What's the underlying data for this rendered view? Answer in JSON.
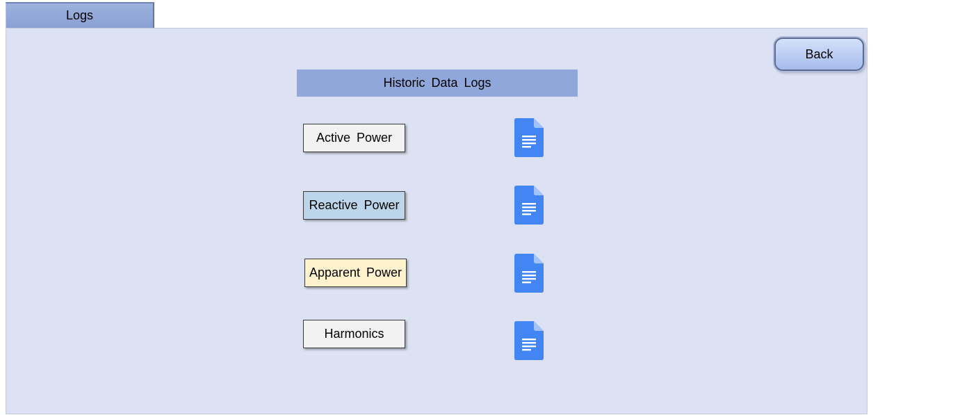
{
  "tab": {
    "label": "Logs"
  },
  "back_button": {
    "label": "Back"
  },
  "section": {
    "title": "Historic Data Logs"
  },
  "logs": [
    {
      "label": "Active Power",
      "bg": "#f2f2f2",
      "icon": "document-icon"
    },
    {
      "label": "Reactive Power",
      "bg": "#bcd5ea",
      "icon": "document-icon"
    },
    {
      "label": "Apparent Power",
      "bg": "#fff2cc",
      "icon": "document-icon"
    },
    {
      "label": "Harmonics",
      "bg": "#f2f2f2",
      "icon": "document-icon"
    }
  ],
  "colors": {
    "panel": "#dce2f3",
    "header": "#8fa7da",
    "tab": "#8aa0d3",
    "doc_icon": "#4285f4",
    "doc_icon_fold": "#a1c2fa"
  }
}
